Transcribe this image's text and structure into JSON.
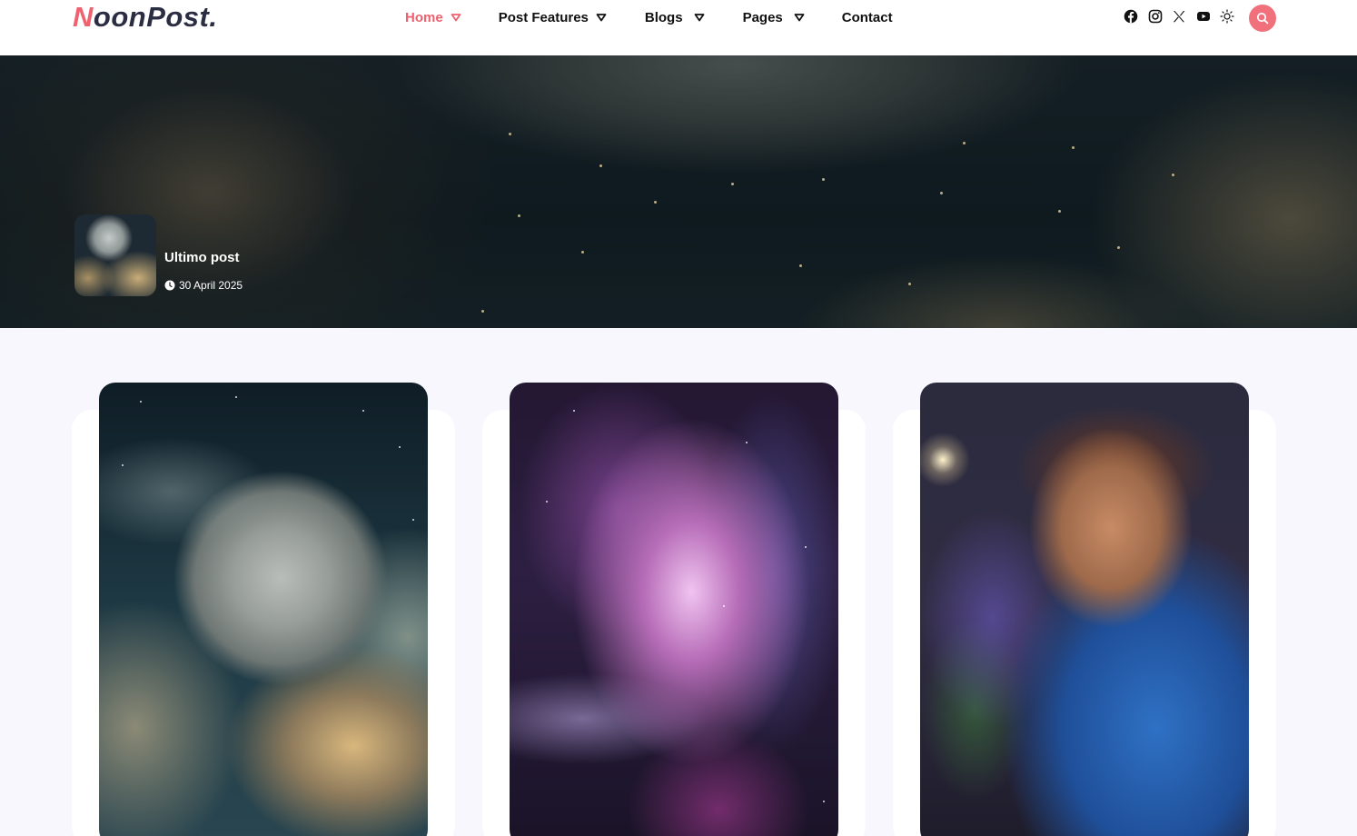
{
  "brand": {
    "logo_first": "N",
    "logo_rest": "oonPost.",
    "accent_color": "#f0616f"
  },
  "nav": {
    "items": [
      {
        "label": "Home",
        "active": true,
        "has_dropdown": true
      },
      {
        "label": "Post Features",
        "active": false,
        "has_dropdown": true
      },
      {
        "label": "Blogs",
        "active": false,
        "has_dropdown": true
      },
      {
        "label": "Pages",
        "active": false,
        "has_dropdown": true
      },
      {
        "label": "Contact",
        "active": false,
        "has_dropdown": false
      }
    ]
  },
  "header_actions": {
    "socials": [
      "facebook-icon",
      "instagram-icon",
      "x-twitter-icon",
      "youtube-icon"
    ],
    "theme_toggle": "sun-icon",
    "search": "search-icon"
  },
  "hero": {
    "post_title": "Ultimo post",
    "post_date": "30 April 2025",
    "thumbnail": "moon-clouds-thumbnail"
  },
  "cards": [
    {
      "image": "moon-clouds-illustration"
    },
    {
      "image": "purple-nebula-illustration"
    },
    {
      "image": "bearded-gamer-with-headphones-illustration"
    }
  ]
}
